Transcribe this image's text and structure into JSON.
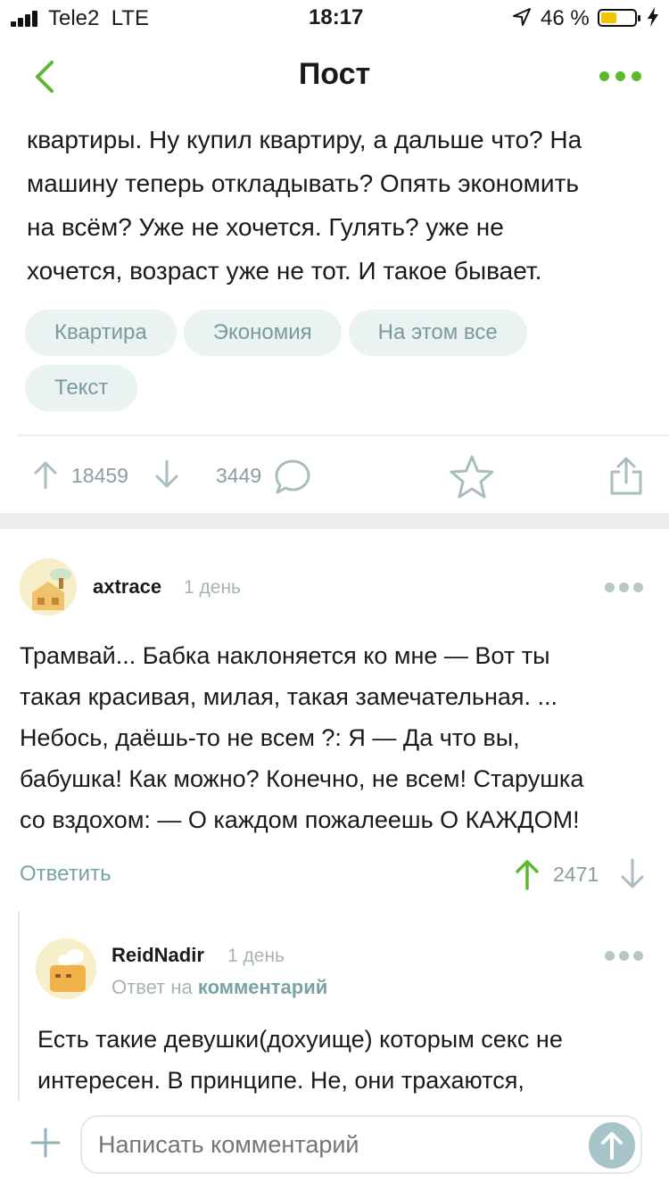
{
  "status_bar": {
    "carrier": "Tele2",
    "network": "LTE",
    "time": "18:17",
    "battery_percent": "46 %",
    "battery_level": 0.46
  },
  "nav": {
    "title": "Пост",
    "back_icon": "chevron-left-icon",
    "more_icon": "more-dots-icon"
  },
  "post": {
    "text_lines": [
      "квартиры. Ну купил квартиру, а дальше что? На",
      "машину теперь откладывать? Опять экономить",
      "на всём? Уже не хочется. Гулять? уже не",
      "хочется, возраст уже не тот. И такое бывает."
    ],
    "tags": [
      "Квартира",
      "Экономия",
      "На этом все",
      "Текст"
    ],
    "rating": "18459",
    "comments_count": "3449"
  },
  "comments": [
    {
      "author": "axtrace",
      "time": "1 день",
      "text_lines": [
        "Трамвай... Бабка наклоняется ко мне — Вот ты",
        "такая красивая, милая, такая замечательная. ...",
        "Небось, даёшь-то не всем ?: Я — Да что вы,",
        "бабушка! Как можно? Конечно, не всем! Старушка",
        "со вздохом: — О каждом пожалеешь О КАЖДОМ!"
      ],
      "reply_label": "Ответить",
      "rating": "2471"
    },
    {
      "author": "ReidNadir",
      "time": "1 день",
      "reply_prefix": "Ответ на",
      "reply_link": "комментарий",
      "text_lines": [
        "Есть такие девушки(дохуище) которым секс не",
        "интересен. В принципе. Не, они трахаются,"
      ]
    }
  ],
  "composer": {
    "placeholder": "Написать комментарий"
  },
  "colors": {
    "accent_green": "#5cb82c",
    "muted_teal": "#7aa2a6",
    "tag_bg": "#eaf2f2"
  }
}
